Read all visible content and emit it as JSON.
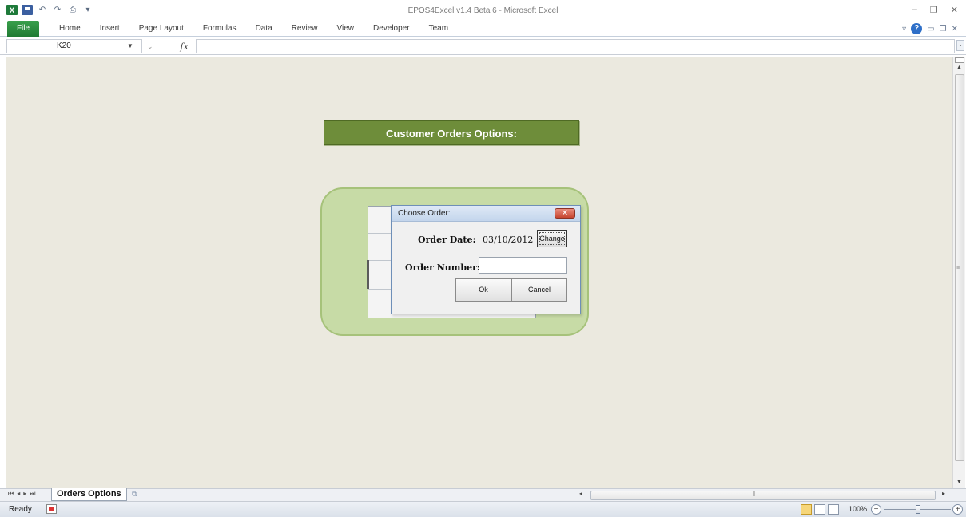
{
  "window": {
    "title": "EPOS4Excel v1.4 Beta 6  -  Microsoft Excel"
  },
  "quick_access": {
    "icons": [
      "excel-app-icon",
      "save-icon",
      "undo-icon",
      "redo-icon",
      "print-icon",
      "customize-icon"
    ]
  },
  "ribbon": {
    "file_label": "File",
    "tabs": [
      "Home",
      "Insert",
      "Page Layout",
      "Formulas",
      "Data",
      "Review",
      "View",
      "Developer",
      "Team"
    ]
  },
  "formula_bar": {
    "name_box": "K20",
    "fx_label": "fx",
    "formula_value": ""
  },
  "sheet": {
    "banner_title": "Customer Orders Options:",
    "colors": {
      "background": "#ebe9df",
      "banner": "#6e8d3a",
      "panel": "#c7dba6"
    }
  },
  "dialog": {
    "title": "Choose Order:",
    "close_label": "✕",
    "order_date_label": "Order Date:",
    "order_date_value": "03/10/2012",
    "change_button": "Change",
    "order_number_label": "Order Number:",
    "order_number_value": "",
    "ok_button": "Ok",
    "cancel_button": "Cancel"
  },
  "sheet_tabs": {
    "active": "Orders Options"
  },
  "status_bar": {
    "status": "Ready",
    "zoom": "100%"
  }
}
